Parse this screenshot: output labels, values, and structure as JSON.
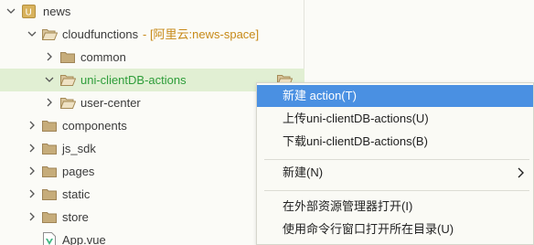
{
  "tree": {
    "root": {
      "label": "news",
      "icon": "project-icon"
    },
    "items": [
      {
        "label": "cloudfunctions",
        "hint": "- [阿里云:news-space]"
      },
      {
        "label": "common"
      },
      {
        "label": "uni-clientDB-actions"
      },
      {
        "label": "user-center"
      },
      {
        "label": "components"
      },
      {
        "label": "js_sdk"
      },
      {
        "label": "pages"
      },
      {
        "label": "static"
      },
      {
        "label": "store"
      },
      {
        "label": "App.vue"
      }
    ]
  },
  "context_menu": {
    "items": [
      {
        "label": "新建 action(T)"
      },
      {
        "label": "上传uni-clientDB-actions(U)"
      },
      {
        "label": "下载uni-clientDB-actions(B)"
      },
      {
        "label": "新建(N)"
      },
      {
        "label": "在外部资源管理器打开(I)"
      },
      {
        "label": "使用命令行窗口打开所在目录(U)"
      }
    ]
  },
  "colors": {
    "selection": "#e1efd3",
    "highlight": "#4a90e2",
    "folder": "#c6ac7a",
    "hint": "#c78a18",
    "selected_text": "#2e9d3a"
  }
}
